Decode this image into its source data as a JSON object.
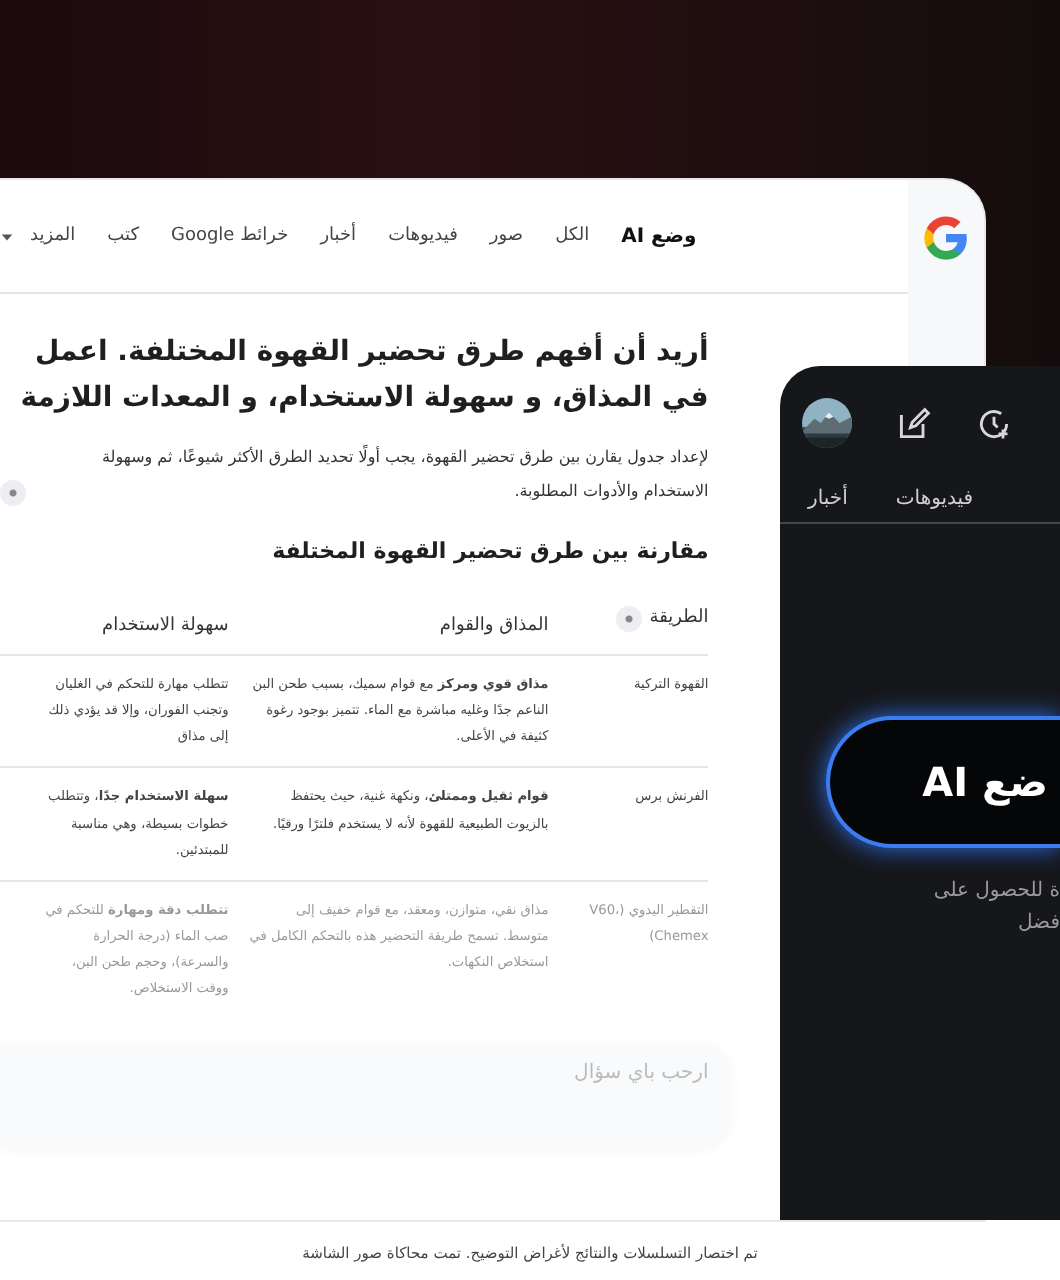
{
  "results_panel": {
    "nav": [
      {
        "label": "وضع AI",
        "selected": true,
        "dropdown": false
      },
      {
        "label": "الكل",
        "selected": false,
        "dropdown": false
      },
      {
        "label": "صور",
        "selected": false,
        "dropdown": false
      },
      {
        "label": "فيديوهات",
        "selected": false,
        "dropdown": false
      },
      {
        "label": "أخبار",
        "selected": false,
        "dropdown": false
      },
      {
        "label": "خرائط Google",
        "selected": false,
        "dropdown": false
      },
      {
        "label": "كتب",
        "selected": false,
        "dropdown": false
      },
      {
        "label": "المزيد",
        "selected": false,
        "dropdown": true
      }
    ],
    "question": "أريد أن أفهم طرق تحضير القهوة المختلفة. اعمل في المذاق، و سهولة الاستخدام، و المعدات اللازمة",
    "answer": "لإعداد جدول يقارن بين طرق تحضير القهوة، يجب أولًا تحديد الطرق الأكثر شيوعًا، ثم وسهولة الاستخدام والأدوات المطلوبة.",
    "table_title": "مقارنة بين طرق تحضير القهوة المختلفة",
    "table": {
      "columns": [
        "الطريقة",
        "المذاق والقوام",
        "سهولة الاستخدام"
      ],
      "rows": [
        {
          "faded": false,
          "cells": [
            "القهوة التركية",
            "**مذاق قوي ومركز** مع قوام سميك، بسبب طحن البن الناعم جدًا وغليه مباشرة مع الماء. تتميز بوجود رغوة كثيفة في الأعلى.",
            "تتطلب مهارة للتحكم في الغليان وتجنب الفوران، وإلا قد يؤدي ذلك إلى مذاق"
          ]
        },
        {
          "faded": false,
          "cells": [
            "الفرنش برس",
            "**قوام ثقيل وممتلئ**، ونكهة غنية، حيث يحتفظ بالزيوت الطبيعية للقهوة لأنه لا يستخدم فلترًا ورقيًا.",
            "**سهلة الاستخدام جدًا**، وتتطلب خطوات بسيطة، وهي مناسبة للمبتدئين."
          ]
        },
        {
          "faded": true,
          "cells": [
            "التقطير اليدوي (V60، Chemex)",
            "مذاق نقي، متوازن، ومعقد، مع قوام خفيف إلى متوسط. تسمح طريقة التحضير هذه بالتحكم الكامل في استخلاص النكهات.",
            "**تتطلب دقة ومهارة** للتحكم في صب الماء (درجة الحرارة والسرعة)، وحجم طحن البن، ووقت الاستخلاص."
          ]
        }
      ]
    },
    "search": {
      "placeholder": "ارحب باي سؤال"
    }
  },
  "phone": {
    "tabs": [
      "فيديوهات",
      "أخبار"
    ],
    "ai_button": "ضع AI",
    "prompt": "ة للحصول على\nفضل"
  },
  "footnote": "تم اختصار التسلسلات والنتائج لأغراض التوضيح. تمت محاكاة صور الشاشة"
}
